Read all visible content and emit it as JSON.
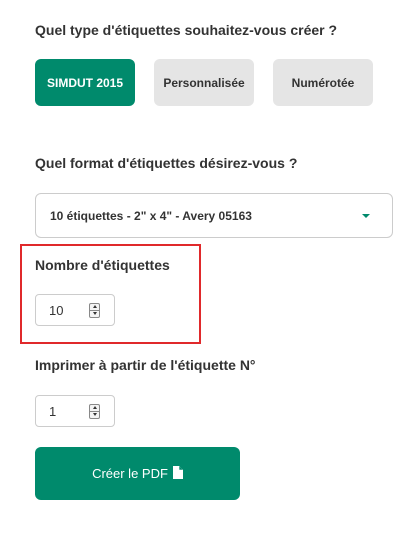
{
  "colors": {
    "accent": "#008a6c",
    "inactive_button": "#e5e5e5",
    "highlight_border": "#e0292b"
  },
  "label_type": {
    "question": "Quel type d'étiquettes souhaitez-vous créer ?",
    "options": [
      {
        "label": "SIMDUT 2015",
        "selected": true
      },
      {
        "label": "Personnalisée",
        "selected": false
      },
      {
        "label": "Numérotée",
        "selected": false
      }
    ]
  },
  "label_format": {
    "question": "Quel format d'étiquettes désirez-vous ?",
    "selected_value": "10 étiquettes - 2\" x 4\" - Avery 05163",
    "icon": "caret-down-icon"
  },
  "label_count": {
    "label": "Nombre d'étiquettes",
    "value": "10"
  },
  "start_label": {
    "label": "Imprimer à partir de l'étiquette N°",
    "value": "1"
  },
  "create_pdf": {
    "label": "Créer le PDF",
    "icon": "file-icon"
  }
}
